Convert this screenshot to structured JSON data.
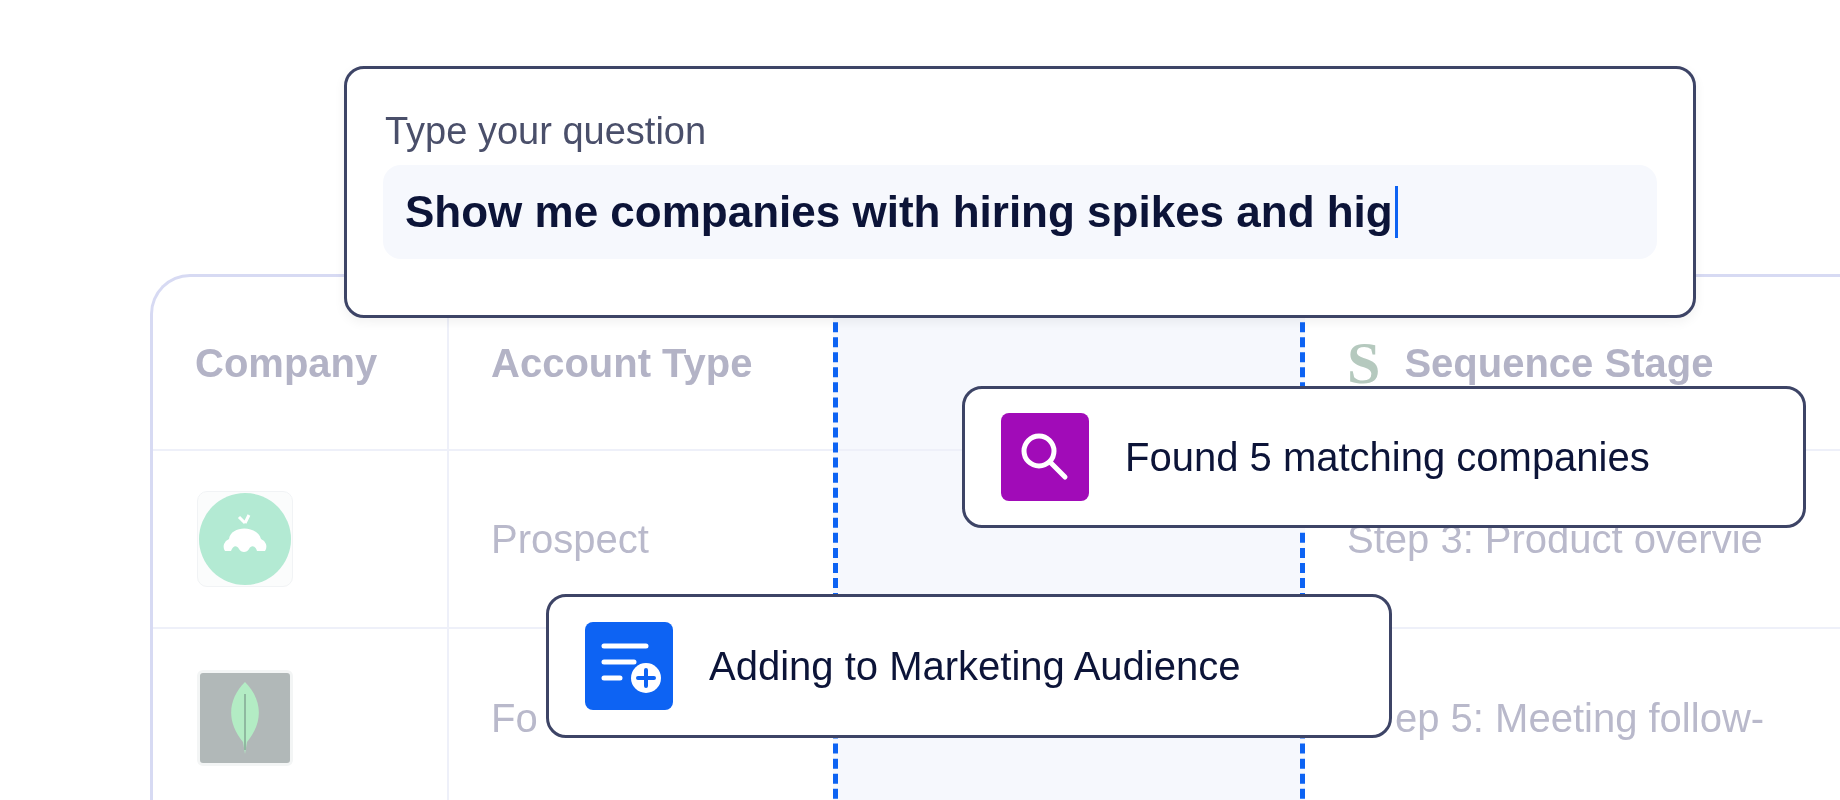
{
  "question": {
    "label": "Type your question",
    "value": "Show me companies with hiring spikes and hig"
  },
  "table": {
    "columns": [
      {
        "label": "Company",
        "highlighted": false
      },
      {
        "label": "Account Type",
        "highlighted": false
      },
      {
        "highlighted": true
      },
      {
        "label": "Sequence Stage",
        "logo": "S",
        "highlighted": false
      }
    ],
    "rows": [
      {
        "kind": "circle-logo",
        "account_type": "Prospect",
        "sequence_stage": "Step 3: Product overvie"
      },
      {
        "kind": "leaf-logo",
        "account_type": "Fo",
        "sequence_stage": "ep 5: Meeting follow-"
      }
    ]
  },
  "notifications": [
    {
      "kind": "search",
      "text": "Found 5 matching companies"
    },
    {
      "kind": "audience",
      "text": "Adding to Marketing Audience"
    }
  ]
}
